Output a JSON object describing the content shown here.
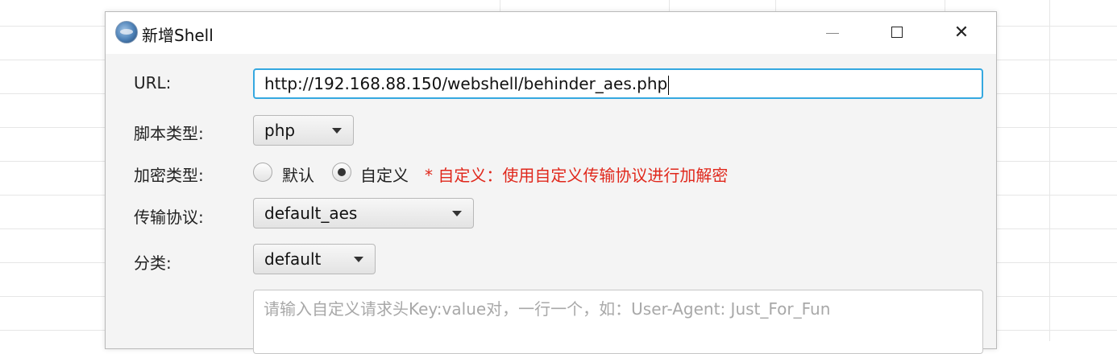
{
  "dialog": {
    "title": "新增Shell",
    "icon": "app-globe-icon",
    "window_controls": [
      "minimize-icon",
      "maximize-icon",
      "close-icon"
    ]
  },
  "form": {
    "url_label": "URL:",
    "url_value": "http://192.168.88.150/webshell/behinder_aes.php",
    "script_type_label": "脚本类型:",
    "script_type_value": "php",
    "encryption_label": "加密类型:",
    "encryption_options": [
      {
        "label": "默认",
        "checked": false
      },
      {
        "label": "自定义",
        "checked": true
      }
    ],
    "encryption_note": "* 自定义：使用自定义传输协议进行加解密",
    "protocol_label": "传输协议:",
    "protocol_value": "default_aes",
    "category_label": "分类:",
    "category_value": "default",
    "headers_placeholder": "请输入自定义请求头Key:value对，一行一个，如：User-Agent: Just_For_Fun"
  },
  "colors": {
    "focus_border": "#35a8e0",
    "note_text": "#e0281c",
    "dialog_bg": "#f4f4f4"
  }
}
